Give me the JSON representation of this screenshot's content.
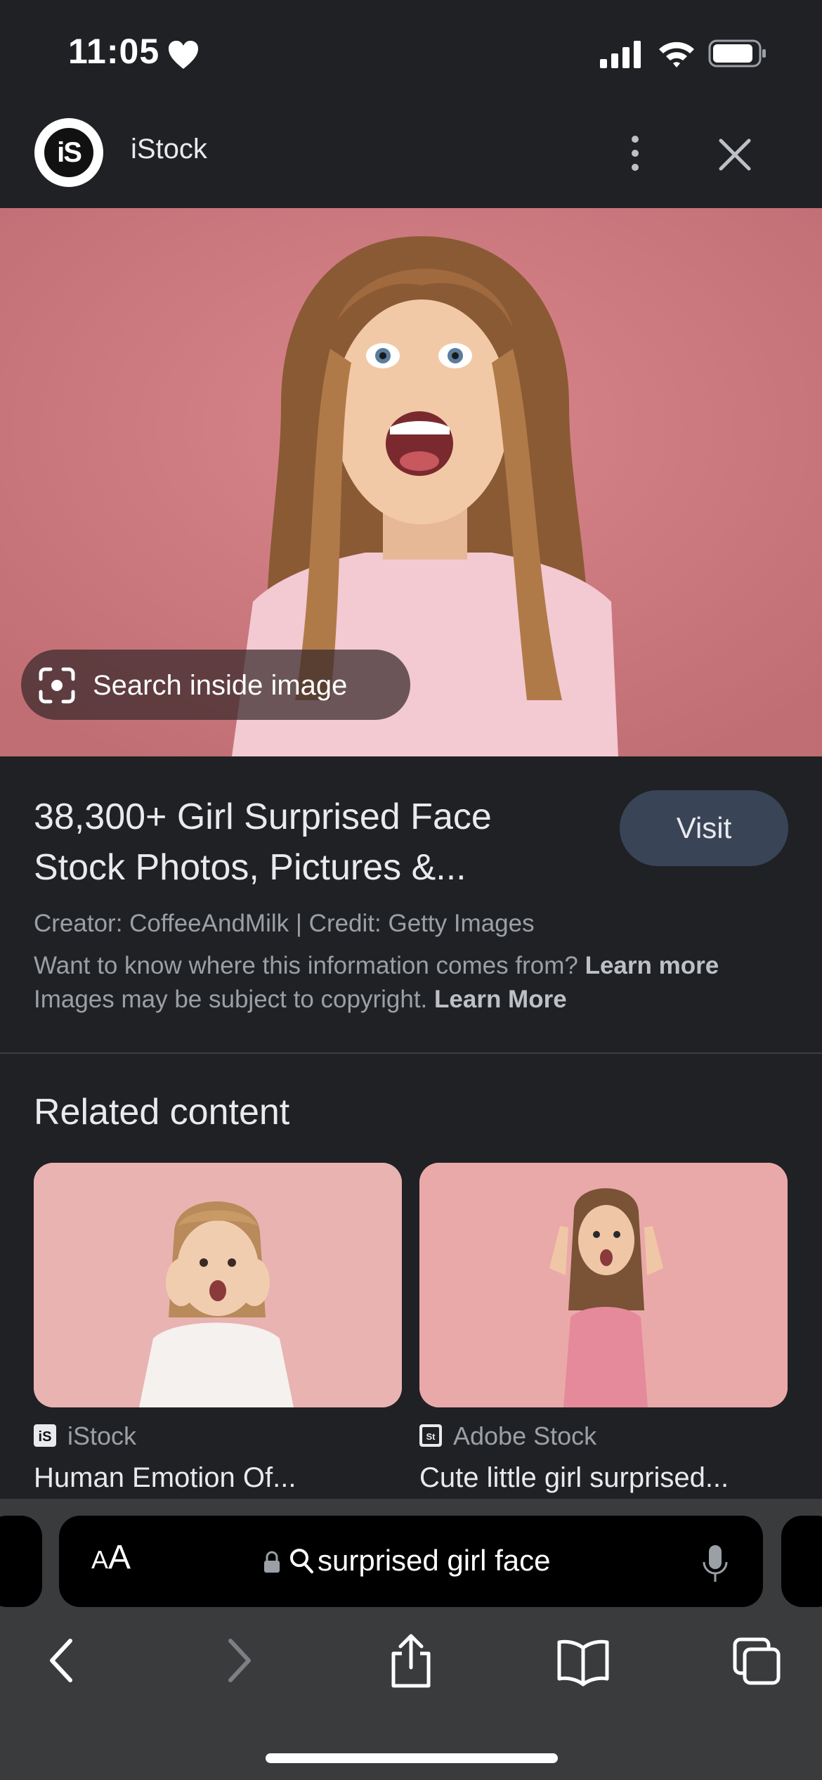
{
  "status_bar": {
    "time": "11:05",
    "icons": [
      "heart-icon",
      "signal-icon",
      "wifi-icon",
      "battery-icon"
    ]
  },
  "header": {
    "logo_text": "iS",
    "site_name": "iStock",
    "icons": [
      "more-vert-icon",
      "close-icon"
    ]
  },
  "hero": {
    "search_inside_label": "Search inside image",
    "background_color": "#c97479"
  },
  "result": {
    "title_line1": "38,300+ Girl Surprised Face",
    "title_line2": "Stock Photos, Pictures &...",
    "visit_label": "Visit",
    "credit": "Creator: CoffeeAndMilk | Credit: Getty Images",
    "info_text": "Want to know where this information comes from?",
    "info_link": "Learn more",
    "copyright_text": "Images may be subject to copyright.",
    "copyright_link": "Learn More"
  },
  "related": {
    "heading": "Related content",
    "cards": [
      {
        "source": "iStock",
        "title": "Human Emotion Of...",
        "icon": "istock-icon"
      },
      {
        "source": "Adobe Stock",
        "title": "Cute little girl surprised...",
        "icon": "adobe-stock-icon"
      }
    ]
  },
  "browser": {
    "text_size_label_small": "A",
    "text_size_label_large": "A",
    "address": "surprised girl face",
    "toolbar_icons": [
      "back-icon",
      "forward-icon",
      "share-icon",
      "bookmarks-icon",
      "tabs-icon"
    ]
  },
  "colors": {
    "background": "#202124",
    "visit_button": "#394457",
    "bottom_bar": "#3a3b3d"
  }
}
